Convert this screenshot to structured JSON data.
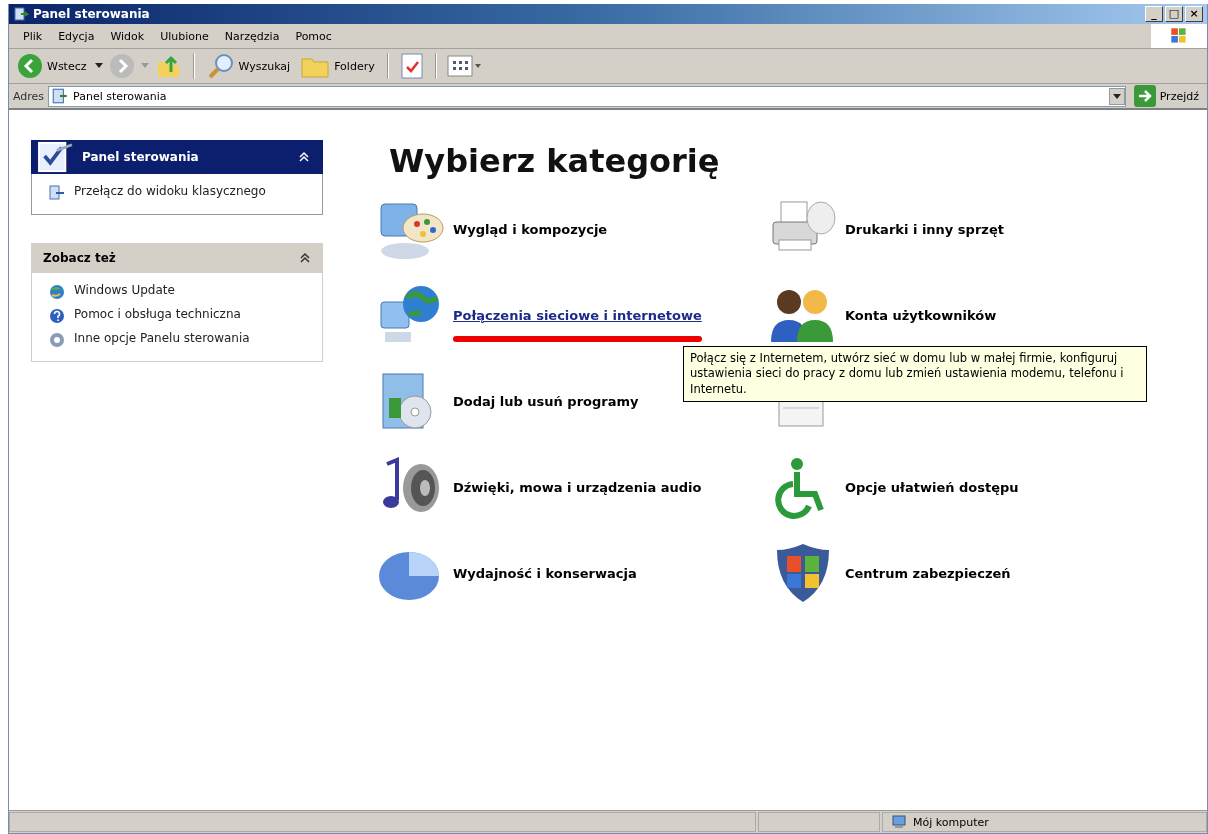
{
  "window": {
    "title": "Panel sterowania",
    "controls": [
      "_",
      "□",
      "×"
    ]
  },
  "menu": [
    "Plik",
    "Edycja",
    "Widok",
    "Ulubione",
    "Narzędzia",
    "Pomoc"
  ],
  "toolbar": {
    "back": "Wstecz",
    "search": "Wyszukaj",
    "folders": "Foldery"
  },
  "address": {
    "label": "Adres",
    "value": "Panel sterowania",
    "go": "Przejdź"
  },
  "sidebar": [
    {
      "title": "Panel sterowania",
      "kind": "primary",
      "items": [
        "Przełącz do widoku klasycznego"
      ]
    },
    {
      "title": "Zobacz też",
      "kind": "secondary",
      "items": [
        "Windows Update",
        "Pomoc i obsługa techniczna",
        "Inne opcje Panelu sterowania"
      ]
    }
  ],
  "heading": "Wybierz kategorię",
  "categories": [
    {
      "label": "Wygląd i kompozycje",
      "hovered": false,
      "highlighted": false
    },
    {
      "label": "Drukarki i inny sprzęt",
      "hovered": false,
      "highlighted": false
    },
    {
      "label": "Połączenia sieciowe i internetowe",
      "hovered": true,
      "highlighted": true
    },
    {
      "label": "Konta użytkowników",
      "hovered": false,
      "highlighted": false
    },
    {
      "label": "Dodaj lub usuń programy",
      "hovered": false,
      "highlighted": false
    },
    {
      "hovered": false,
      "highlighted": false
    },
    {
      "label": "Dźwięki, mowa i urządzenia audio",
      "hovered": false,
      "highlighted": false
    },
    {
      "label": "Opcje ułatwień dostępu",
      "hovered": false,
      "highlighted": false
    },
    {
      "label": "Wydajność i konserwacja",
      "hovered": false,
      "highlighted": false
    },
    {
      "label": "Centrum zabezpieczeń",
      "hovered": false,
      "highlighted": false
    }
  ],
  "tooltip": "Połącz się z Internetem, utwórz sieć w domu lub w małej firmie, konfiguruj ustawienia sieci do pracy z domu lub zmień ustawienia modemu, telefonu i Internetu.",
  "status_bar": {
    "zone": "Mój komputer"
  }
}
